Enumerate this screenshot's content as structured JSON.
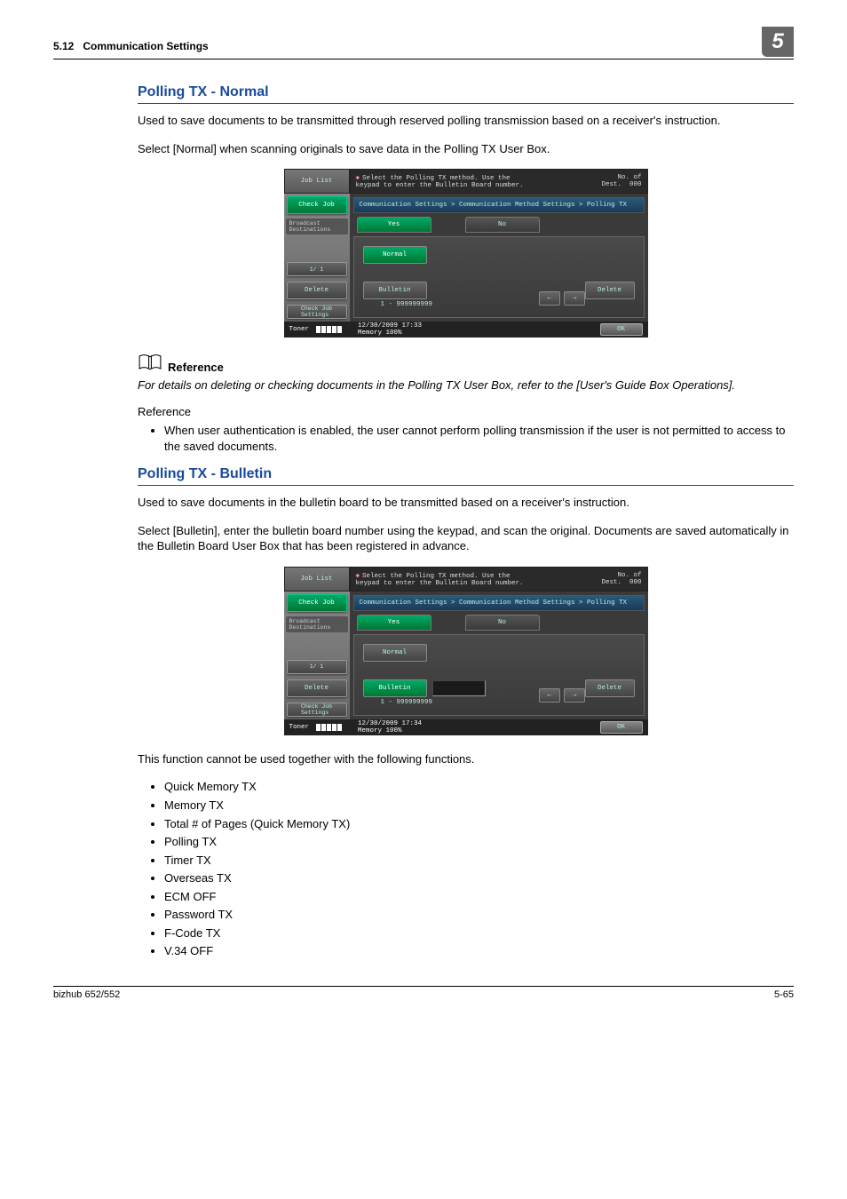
{
  "header": {
    "section": "5.12",
    "title": "Communication Settings",
    "chapter": "5"
  },
  "section1": {
    "heading": "Polling TX - Normal",
    "p1": "Used to save documents to be transmitted through reserved polling transmission based on a receiver's instruction.",
    "p2": "Select [Normal] when scanning originals to save data in the Polling TX User Box."
  },
  "screenshot1": {
    "joblist": "Job List",
    "msg": "Select the Polling TX method. Use the\nkeypad to enter the Bulletin Board number.",
    "nodest_label": "No. of\nDest.",
    "nodest_val": "000",
    "checkjob": "Check Job",
    "broadcast": "Broadcast\nDestinations",
    "pager": "1/  1",
    "delete_left": "Delete",
    "checkjobset": "Check Job\nSettings",
    "breadcrumb": "Communication Settings > Communication Method Settings > Polling TX",
    "yes": "Yes",
    "no": "No",
    "normal": "Normal",
    "bulletin": "Bulletin",
    "range": "1 - 999999999",
    "delete": "Delete",
    "toner": "Toner",
    "datetime": "12/30/2009    17:33",
    "memory": "Memory     100%",
    "ok": "OK",
    "selected": "normal",
    "active_tab": "yes"
  },
  "reference": {
    "label": "Reference",
    "italic": "For details on deleting or checking documents in the Polling TX User Box, refer to the [User's Guide Box Operations].",
    "subhead": "Reference",
    "bullet": "When user authentication is enabled, the user cannot perform polling transmission if the user is not permitted to access to the saved documents."
  },
  "section2": {
    "heading": "Polling TX - Bulletin",
    "p1": "Used to save documents in the bulletin board to be transmitted based on a receiver's instruction.",
    "p2": "Select [Bulletin], enter the bulletin board number using the keypad, and scan the original. Documents are saved automatically in the Bulletin Board User Box that has been registered in advance."
  },
  "screenshot2": {
    "datetime": "12/30/2009    17:34",
    "selected": "bulletin"
  },
  "list_intro": "This function cannot be used together with the following functions.",
  "functions": [
    "Quick Memory TX",
    "Memory TX",
    "Total # of Pages (Quick Memory TX)",
    "Polling TX",
    "Timer TX",
    "Overseas TX",
    "ECM OFF",
    "Password TX",
    "F-Code TX",
    "V.34 OFF"
  ],
  "footer": {
    "left": "bizhub 652/552",
    "right": "5-65"
  }
}
